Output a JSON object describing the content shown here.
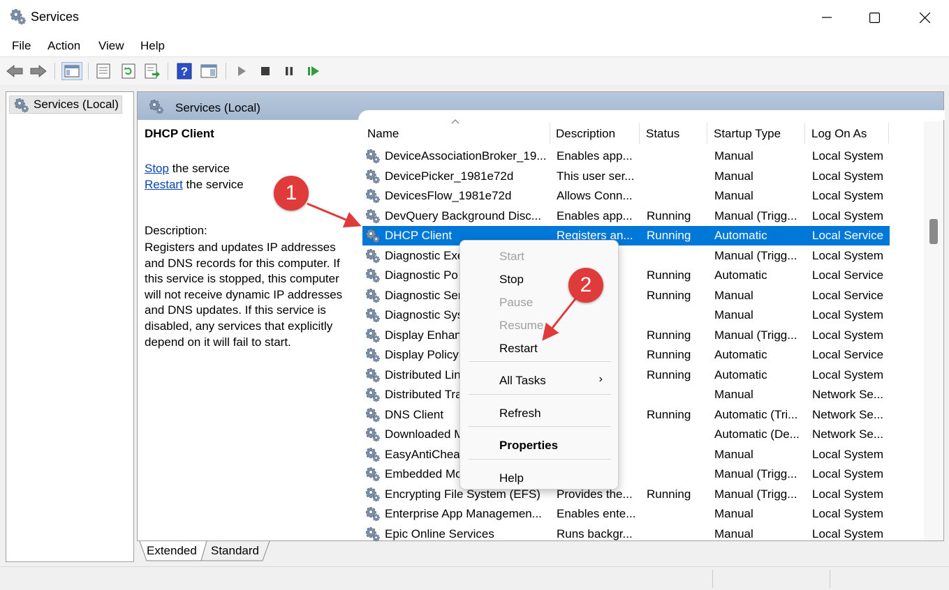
{
  "window": {
    "title": "Services",
    "icon": "gear-icon"
  },
  "menu": [
    "File",
    "Action",
    "View",
    "Help"
  ],
  "toolbar": [
    "back-arrow-icon",
    "forward-arrow-icon",
    "show-hide-console-tree-icon",
    "properties-icon",
    "refresh-icon",
    "export-list-icon",
    "help-icon",
    "show-action-pane-icon",
    "start-service-icon",
    "stop-service-icon",
    "pause-service-icon",
    "resume-service-icon"
  ],
  "tree": {
    "root": "Services (Local)"
  },
  "content": {
    "header": "Services (Local)",
    "selected_name": "DHCP Client",
    "stop_link": "Stop",
    "stop_suffix": " the service",
    "restart_link": "Restart",
    "restart_suffix": " the service",
    "description_label": "Description:",
    "description": "Registers and updates IP addresses and DNS records for this computer. If this service is stopped, this computer will not receive dynamic IP addresses and DNS updates. If this service is disabled, any services that explicitly depend on it will fail to start."
  },
  "columns": [
    "Name",
    "Description",
    "Status",
    "Startup Type",
    "Log On As"
  ],
  "rows": [
    [
      "DeviceAssociationBroker_19...",
      "Enables app...",
      "",
      "Manual",
      "Local System"
    ],
    [
      "DevicePicker_1981e72d",
      "This user ser...",
      "",
      "Manual",
      "Local System"
    ],
    [
      "DevicesFlow_1981e72d",
      "Allows Conn...",
      "",
      "Manual",
      "Local System"
    ],
    [
      "DevQuery Background Disc...",
      "Enables app...",
      "Running",
      "Manual (Trigg...",
      "Local System"
    ],
    [
      "DHCP Client",
      "Registers an...",
      "Running",
      "Automatic",
      "Local Service"
    ],
    [
      "Diagnostic Exe",
      "n...",
      "",
      "Manual (Trigg...",
      "Local System"
    ],
    [
      "Diagnostic Po",
      "s...",
      "Running",
      "Automatic",
      "Local Service"
    ],
    [
      "Diagnostic Ser",
      "s...",
      "Running",
      "Manual",
      "Local Service"
    ],
    [
      "Diagnostic Sys",
      "s...",
      "",
      "Manual",
      "Local System"
    ],
    [
      "Display Enhan",
      "r ...",
      "Running",
      "Manual (Trigg...",
      "Local System"
    ],
    [
      "Display Policy",
      "",
      "Running",
      "Automatic",
      "Local Service"
    ],
    [
      "Distributed Lin",
      "",
      "Running",
      "Automatic",
      "Local System"
    ],
    [
      "Distributed Tra",
      "s ...",
      "",
      "Manual",
      "Network Se..."
    ],
    [
      "DNS Client",
      "",
      "Running",
      "Automatic (Tri...",
      "Network Se..."
    ],
    [
      "Downloaded M",
      "er...",
      "",
      "Automatic (De...",
      "Network Se..."
    ],
    [
      "EasyAntiCheat",
      "o...",
      "",
      "Manual",
      "Local System"
    ],
    [
      "Embedded Mo",
      "d...",
      "",
      "Manual (Trigg...",
      "Local System"
    ],
    [
      "Encrypting File System (EFS)",
      "Provides the...",
      "Running",
      "Manual (Trigg...",
      "Local System"
    ],
    [
      "Enterprise App Managemen...",
      "Enables ente...",
      "",
      "Manual",
      "Local System"
    ],
    [
      "Epic Online Services",
      "Runs backgr...",
      "",
      "Manual",
      "Local System"
    ]
  ],
  "selected_row": 4,
  "context_menu": [
    {
      "label": "Start",
      "disabled": true
    },
    {
      "label": "Stop"
    },
    {
      "label": "Pause",
      "disabled": true
    },
    {
      "label": "Resume",
      "disabled": true
    },
    {
      "label": "Restart"
    },
    {
      "label": "All Tasks",
      "submenu": true
    },
    {
      "label": "Refresh"
    },
    {
      "label": "Properties",
      "bold": true
    },
    {
      "label": "Help"
    }
  ],
  "tabs": [
    "Extended",
    "Standard"
  ],
  "annotations": [
    "1",
    "2"
  ],
  "colors": {
    "selection": "#0078d7",
    "annotation": "#e03b3b",
    "header": "#a3b7cf",
    "link": "#0645ad"
  }
}
